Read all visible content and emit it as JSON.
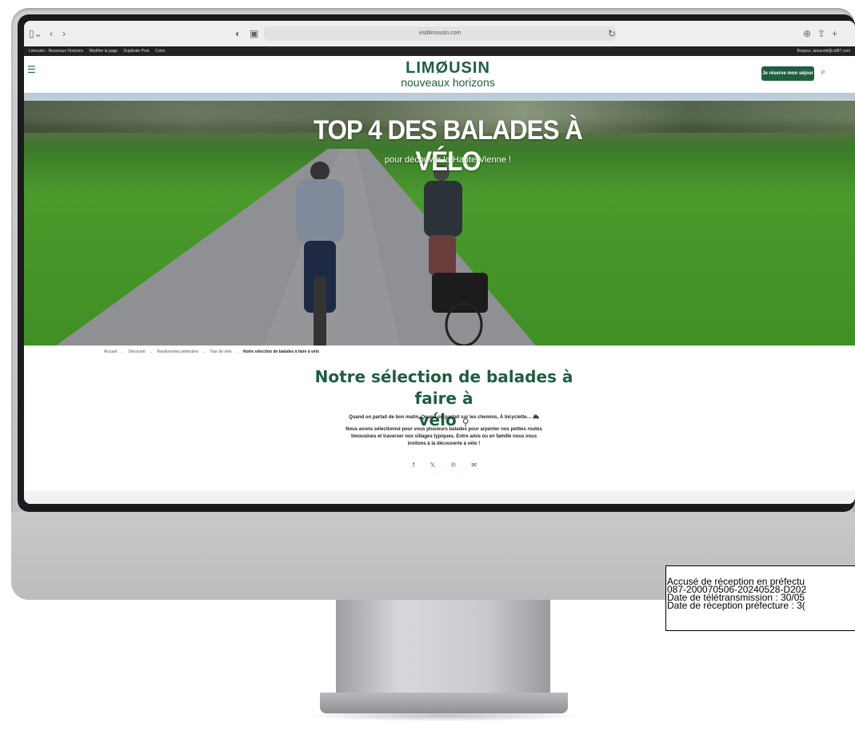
{
  "browser": {
    "url": "visitlimousin.com",
    "icons": [
      "sidebar-icon",
      "back-icon",
      "forward-icon",
      "shield-icon",
      "reader-icon",
      "reload-icon",
      "download-icon",
      "share-icon",
      "new-tab-icon"
    ]
  },
  "admin_bar": {
    "items": [
      "Limousin - Nouveaux Horizons",
      "Modifier la page",
      "Duplicate Post",
      "Créer"
    ],
    "greeting": "Bonjour, amacotti@csf87.com"
  },
  "header": {
    "logo_top": "LIMØUSIN",
    "logo_bottom": "nouveaux horizons",
    "reserve_button": "Je réserve mon séjour",
    "accent_color": "#1d5f40"
  },
  "hero": {
    "title": "TOP 4 DES BALADES À VÉLO",
    "subtitle": "pour découvrir la Haute-Vienne !"
  },
  "breadcrumb": [
    "Accueil",
    "Découvrir",
    "Randonnées pédestres",
    "Tour de vélo",
    "Notre sélection de balades à faire à vélo"
  ],
  "content": {
    "title_line1": "Notre sélection de balades à faire à",
    "title_line2": "vélo",
    "intro": "Quand on partait de bon matin, Quand on partait sur les chemins, À bicyclette…",
    "body_line1": "Nous avons sélectionné pour vous plusieurs balades pour arpenter nos petites routes",
    "body_line2": "limousines et traverser nos villages typiques. Entre amis ou en famille nous vous",
    "body_line3": "invitons à la découverte à vélo !",
    "share": [
      "f",
      "𝕏",
      "℗",
      "✉"
    ]
  },
  "stamp": {
    "line1": "Accusé de réception en préfectu",
    "line2": "087-200070506-20240528-D202",
    "line3": "Date de télétransmission : 30/05",
    "line4": "Date de réception préfecture : 3("
  }
}
